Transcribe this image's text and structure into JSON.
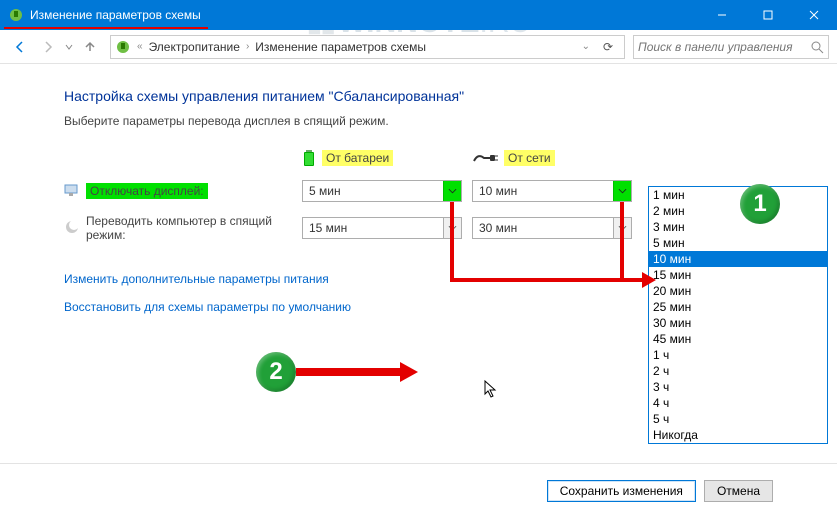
{
  "window": {
    "title": "Изменение параметров схемы"
  },
  "watermark": {
    "text_a": "WINNOTE",
    "text_b": ".RU"
  },
  "nav": {
    "breadcrumb": {
      "a": "Электропитание",
      "b": "Изменение параметров схемы"
    },
    "search_placeholder": "Поиск в панели управления"
  },
  "page": {
    "heading": "Настройка схемы управления питанием \"Сбалансированная\"",
    "subtext": "Выберите параметры перевода дисплея в спящий режим.",
    "col_battery": "От батареи",
    "col_ac": "От сети",
    "row_display": "Отключать дисплей:",
    "row_sleep": "Переводить компьютер в спящий режим:",
    "ddl": {
      "display_batt": "5 мин",
      "display_ac": "10 мин",
      "sleep_batt": "15 мин",
      "sleep_ac": "30 мин"
    },
    "link_adv": "Изменить дополнительные параметры питания",
    "link_restore": "Восстановить для схемы параметры по умолчанию"
  },
  "dropdown": {
    "options": [
      "1 мин",
      "2 мин",
      "3 мин",
      "5 мин",
      "10 мин",
      "15 мин",
      "20 мин",
      "25 мин",
      "30 мин",
      "45 мин",
      "1 ч",
      "2 ч",
      "3 ч",
      "4 ч",
      "5 ч",
      "Никогда"
    ],
    "selected_index": 4
  },
  "footer": {
    "save": "Сохранить изменения",
    "cancel": "Отмена"
  },
  "annotations": {
    "badge1": "1",
    "badge2": "2"
  }
}
